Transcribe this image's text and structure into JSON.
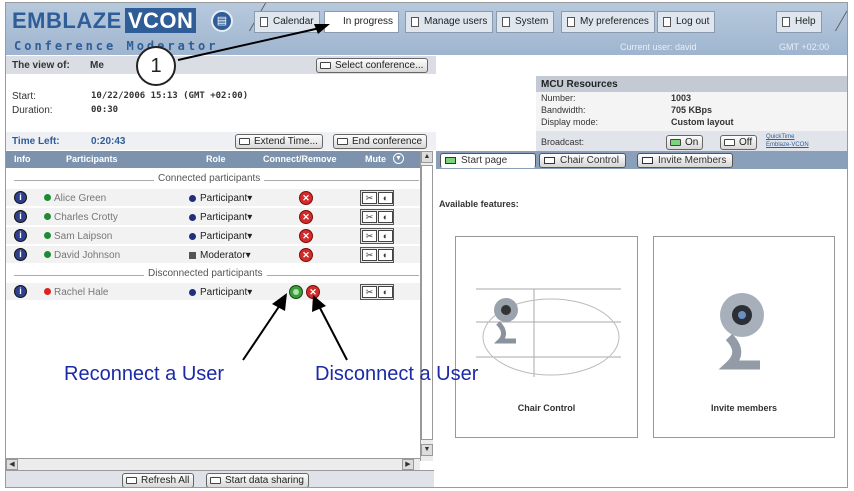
{
  "app": {
    "logo_a": "EMBLAZE",
    "logo_b": "VCON",
    "subtitle": "Conference Moderator",
    "current_user": "Current user: david",
    "timezone": "GMT +02:00"
  },
  "nav": {
    "tabs": [
      "Calendar",
      "In progress",
      "Manage users",
      "System",
      "My preferences",
      "Log out",
      "Help"
    ]
  },
  "conference": {
    "view_of_label": "The view of:",
    "view_of_value": "Me",
    "select_button": "Select conference...",
    "start_label": "Start:",
    "start_value": "10/22/2006 15:13 (GMT +02:00)",
    "duration_label": "Duration:",
    "duration_value": "00:30",
    "time_left_label": "Time Left:",
    "time_left_value": "0:20:43",
    "extend_button": "Extend Time...",
    "end_button": "End conference"
  },
  "mcu": {
    "title": "MCU Resources",
    "number_label": "Number:",
    "number_value": "1003",
    "bandwidth_label": "Bandwidth:",
    "bandwidth_value": "705 KBps",
    "display_label": "Display mode:",
    "display_value": "Custom layout",
    "broadcast_label": "Broadcast:",
    "on_label": "On",
    "off_label": "Off",
    "quicktime_a": "QuickTime",
    "quicktime_b": "Emblaze-VCON"
  },
  "table": {
    "headers": {
      "info": "Info",
      "participants": "Participants",
      "role": "Role",
      "connect": "Connect/Remove",
      "mute": "Mute"
    },
    "connected_label": "Connected participants",
    "disconnected_label": "Disconnected participants",
    "connected": [
      {
        "name": "Alice Green",
        "role": "Participant"
      },
      {
        "name": "Charles Crotty",
        "role": "Participant"
      },
      {
        "name": "Sam Laipson",
        "role": "Participant"
      },
      {
        "name": "David Johnson",
        "role": "Moderator"
      }
    ],
    "disconnected": [
      {
        "name": "Rachel Hale",
        "role": "Participant"
      }
    ]
  },
  "bottom": {
    "refresh": "Refresh All",
    "share": "Start data sharing"
  },
  "right": {
    "tabs": [
      "Start page",
      "Chair Control",
      "Invite Members"
    ],
    "features_label": "Available features:",
    "feature_1": "Chair Control",
    "feature_2": "Invite members"
  },
  "callouts": {
    "number": "1",
    "reconnect": "Reconnect a User",
    "disconnect": "Disconnect a User"
  }
}
